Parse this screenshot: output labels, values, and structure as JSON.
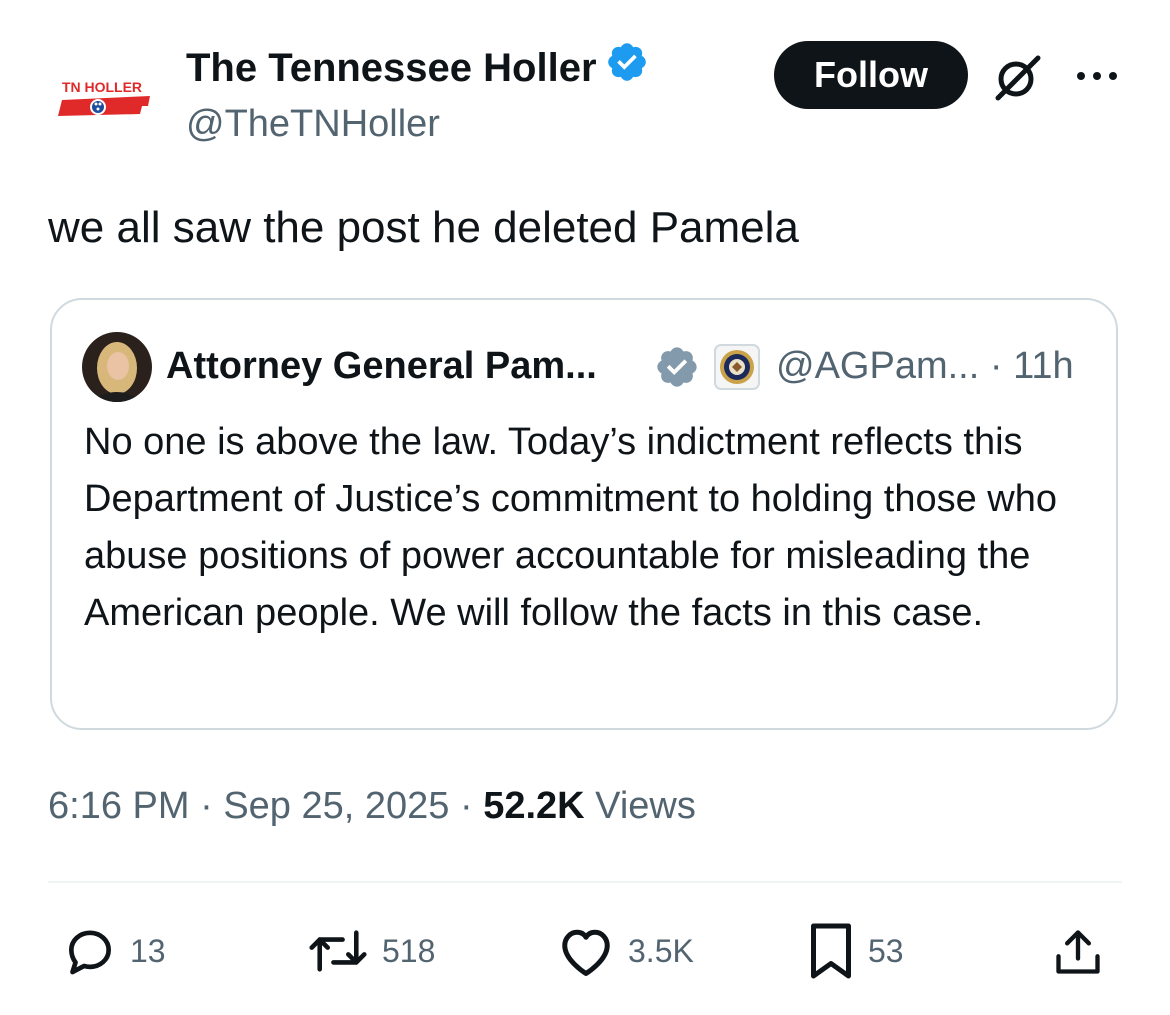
{
  "author": {
    "display_name": "The Tennessee Holler",
    "handle": "@TheTNHoller",
    "logo_text": "TN HOLLER",
    "verified": true,
    "verified_color": "#1d9bf0"
  },
  "follow_label": "Follow",
  "tweet_text": "we all saw the post he deleted Pamela",
  "quote": {
    "display_name": "Attorney General Pam...",
    "handle": "@AGPam...",
    "time": "· 11h",
    "text": "No one is above the law. Today’s indictment reflects this Department of Justice’s commitment to holding those who abuse positions of power accountable for misleading the American people. We will follow the facts in this case.",
    "verified": "gray",
    "affiliate_badge": "doj-seal-icon"
  },
  "meta": {
    "time": "6:16 PM",
    "sep1": "·",
    "date": "Sep 25, 2025",
    "sep2": "·",
    "views_count": "52.2K",
    "views_label": "Views"
  },
  "actions": {
    "replies": "13",
    "reposts": "518",
    "likes": "3.5K",
    "bookmarks": "53"
  },
  "icons": [
    "verified-badge-icon",
    "grok-icon",
    "more-icon",
    "reply-icon",
    "repost-icon",
    "like-icon",
    "bookmark-icon",
    "share-icon"
  ],
  "colors": {
    "text": "#0f1419",
    "secondary": "#536471",
    "border": "#cfd9de",
    "button_bg": "#0f1419",
    "logo_red": "#e02a2a"
  }
}
